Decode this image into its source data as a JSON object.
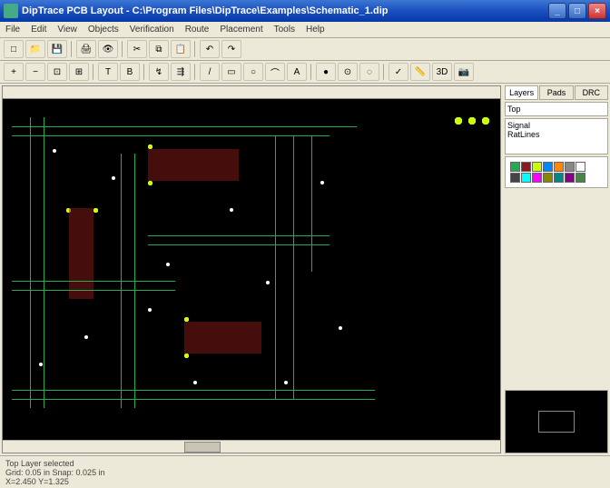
{
  "window": {
    "title": "DipTrace PCB Layout - C:\\Program Files\\DipTrace\\Examples\\Schematic_1.dip",
    "min": "_",
    "max": "□",
    "close": "×"
  },
  "menu": [
    "File",
    "Edit",
    "View",
    "Objects",
    "Verification",
    "Route",
    "Placement",
    "Tools",
    "Help"
  ],
  "toolbar1": {
    "new": "□",
    "open": "📁",
    "save": "💾",
    "print": "🖨",
    "preview": "👁",
    "cut": "✂",
    "copy": "⧉",
    "paste": "📋",
    "undo": "↶",
    "redo": "↷"
  },
  "toolbar2": {
    "zoom_in": "+",
    "zoom_out": "−",
    "zoom_fit": "⊡",
    "zoom_win": "⊞",
    "layer_top": "T",
    "layer_bot": "B",
    "route_man": "↯",
    "route_auto": "⇶",
    "line": "/",
    "rect": "▭",
    "circle": "○",
    "arc": "⌒",
    "text": "A",
    "pad": "●",
    "via": "⊙",
    "hole": "◌",
    "drc": "✓",
    "measure": "📏",
    "3d": "3D",
    "camera": "📷"
  },
  "side": {
    "tabs": [
      "Layers",
      "Pads",
      "DRC"
    ],
    "active_tab": 0,
    "layers_label": "Top",
    "signal": "Signal",
    "ratlines": "RatLines",
    "layer_colors": [
      "#2a5",
      "#8b1a1a",
      "#cf0",
      "#08f",
      "#f80",
      "#888",
      "#fff",
      "#444",
      "#0ff",
      "#f0f",
      "#880",
      "#088",
      "#808",
      "#484"
    ]
  },
  "status": {
    "line1": "Top Layer selected",
    "line2": "Grid: 0.05 in  Snap: 0.025 in",
    "line3": "X=2.450  Y=1.325"
  }
}
